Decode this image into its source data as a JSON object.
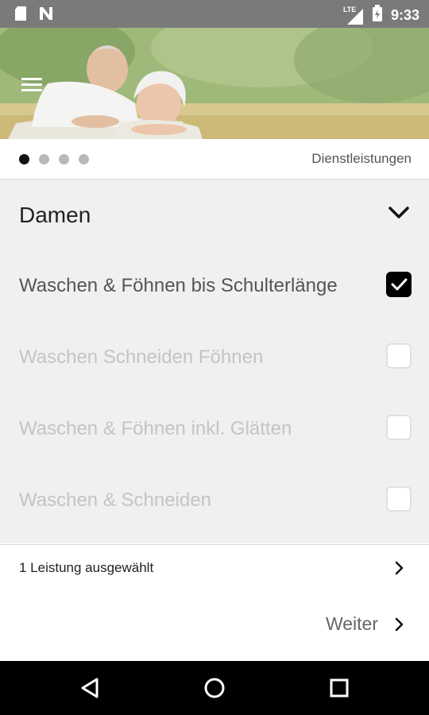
{
  "status_bar": {
    "time": "9:33",
    "network": "LTE",
    "icons": [
      "sd-card-icon",
      "n-icon",
      "lte-signal-icon",
      "battery-charging-icon"
    ]
  },
  "pager": {
    "label": "Dienstleistungen",
    "pages": 4,
    "active_page": 1
  },
  "section": {
    "title": "Damen",
    "items": [
      {
        "label": "Waschen & Föhnen bis Schulterlänge",
        "checked": true
      },
      {
        "label": "Waschen Schneiden Föhnen",
        "checked": false
      },
      {
        "label": "Waschen & Föhnen inkl. Glätten",
        "checked": false
      },
      {
        "label": "Waschen & Schneiden",
        "checked": false
      }
    ]
  },
  "summary": {
    "label": "1 Leistung ausgewählt"
  },
  "footer": {
    "next_label": "Weiter"
  },
  "navigation": {
    "icons": [
      "back-icon",
      "home-icon",
      "recents-icon"
    ]
  },
  "colors": {
    "status_bar": "#7a7a7a",
    "section_bg": "#f0f0f0",
    "checked_box": "#000000",
    "dim_text": "#c4c4c4"
  }
}
